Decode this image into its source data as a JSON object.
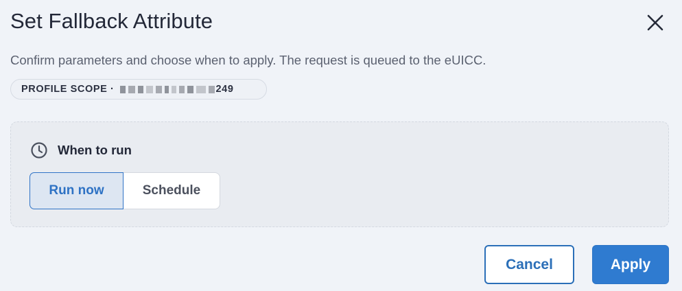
{
  "dialog": {
    "title": "Set Fallback Attribute",
    "subtitle": "Confirm parameters and choose when to apply. The request is queued to the eUICC.",
    "close_icon": "close-icon"
  },
  "scope": {
    "label": "PROFILE SCOPE ·",
    "value_suffix": "249"
  },
  "run": {
    "icon": "clock-icon",
    "title": "When to run",
    "options": [
      {
        "label": "Run now",
        "selected": true
      },
      {
        "label": "Schedule",
        "selected": false
      }
    ]
  },
  "actions": {
    "cancel_label": "Cancel",
    "apply_label": "Apply"
  },
  "colors": {
    "background": "#f0f3f8",
    "accent": "#2f7bd0",
    "accent_text": "#2e72c4",
    "panel": "#e9ecf1"
  }
}
